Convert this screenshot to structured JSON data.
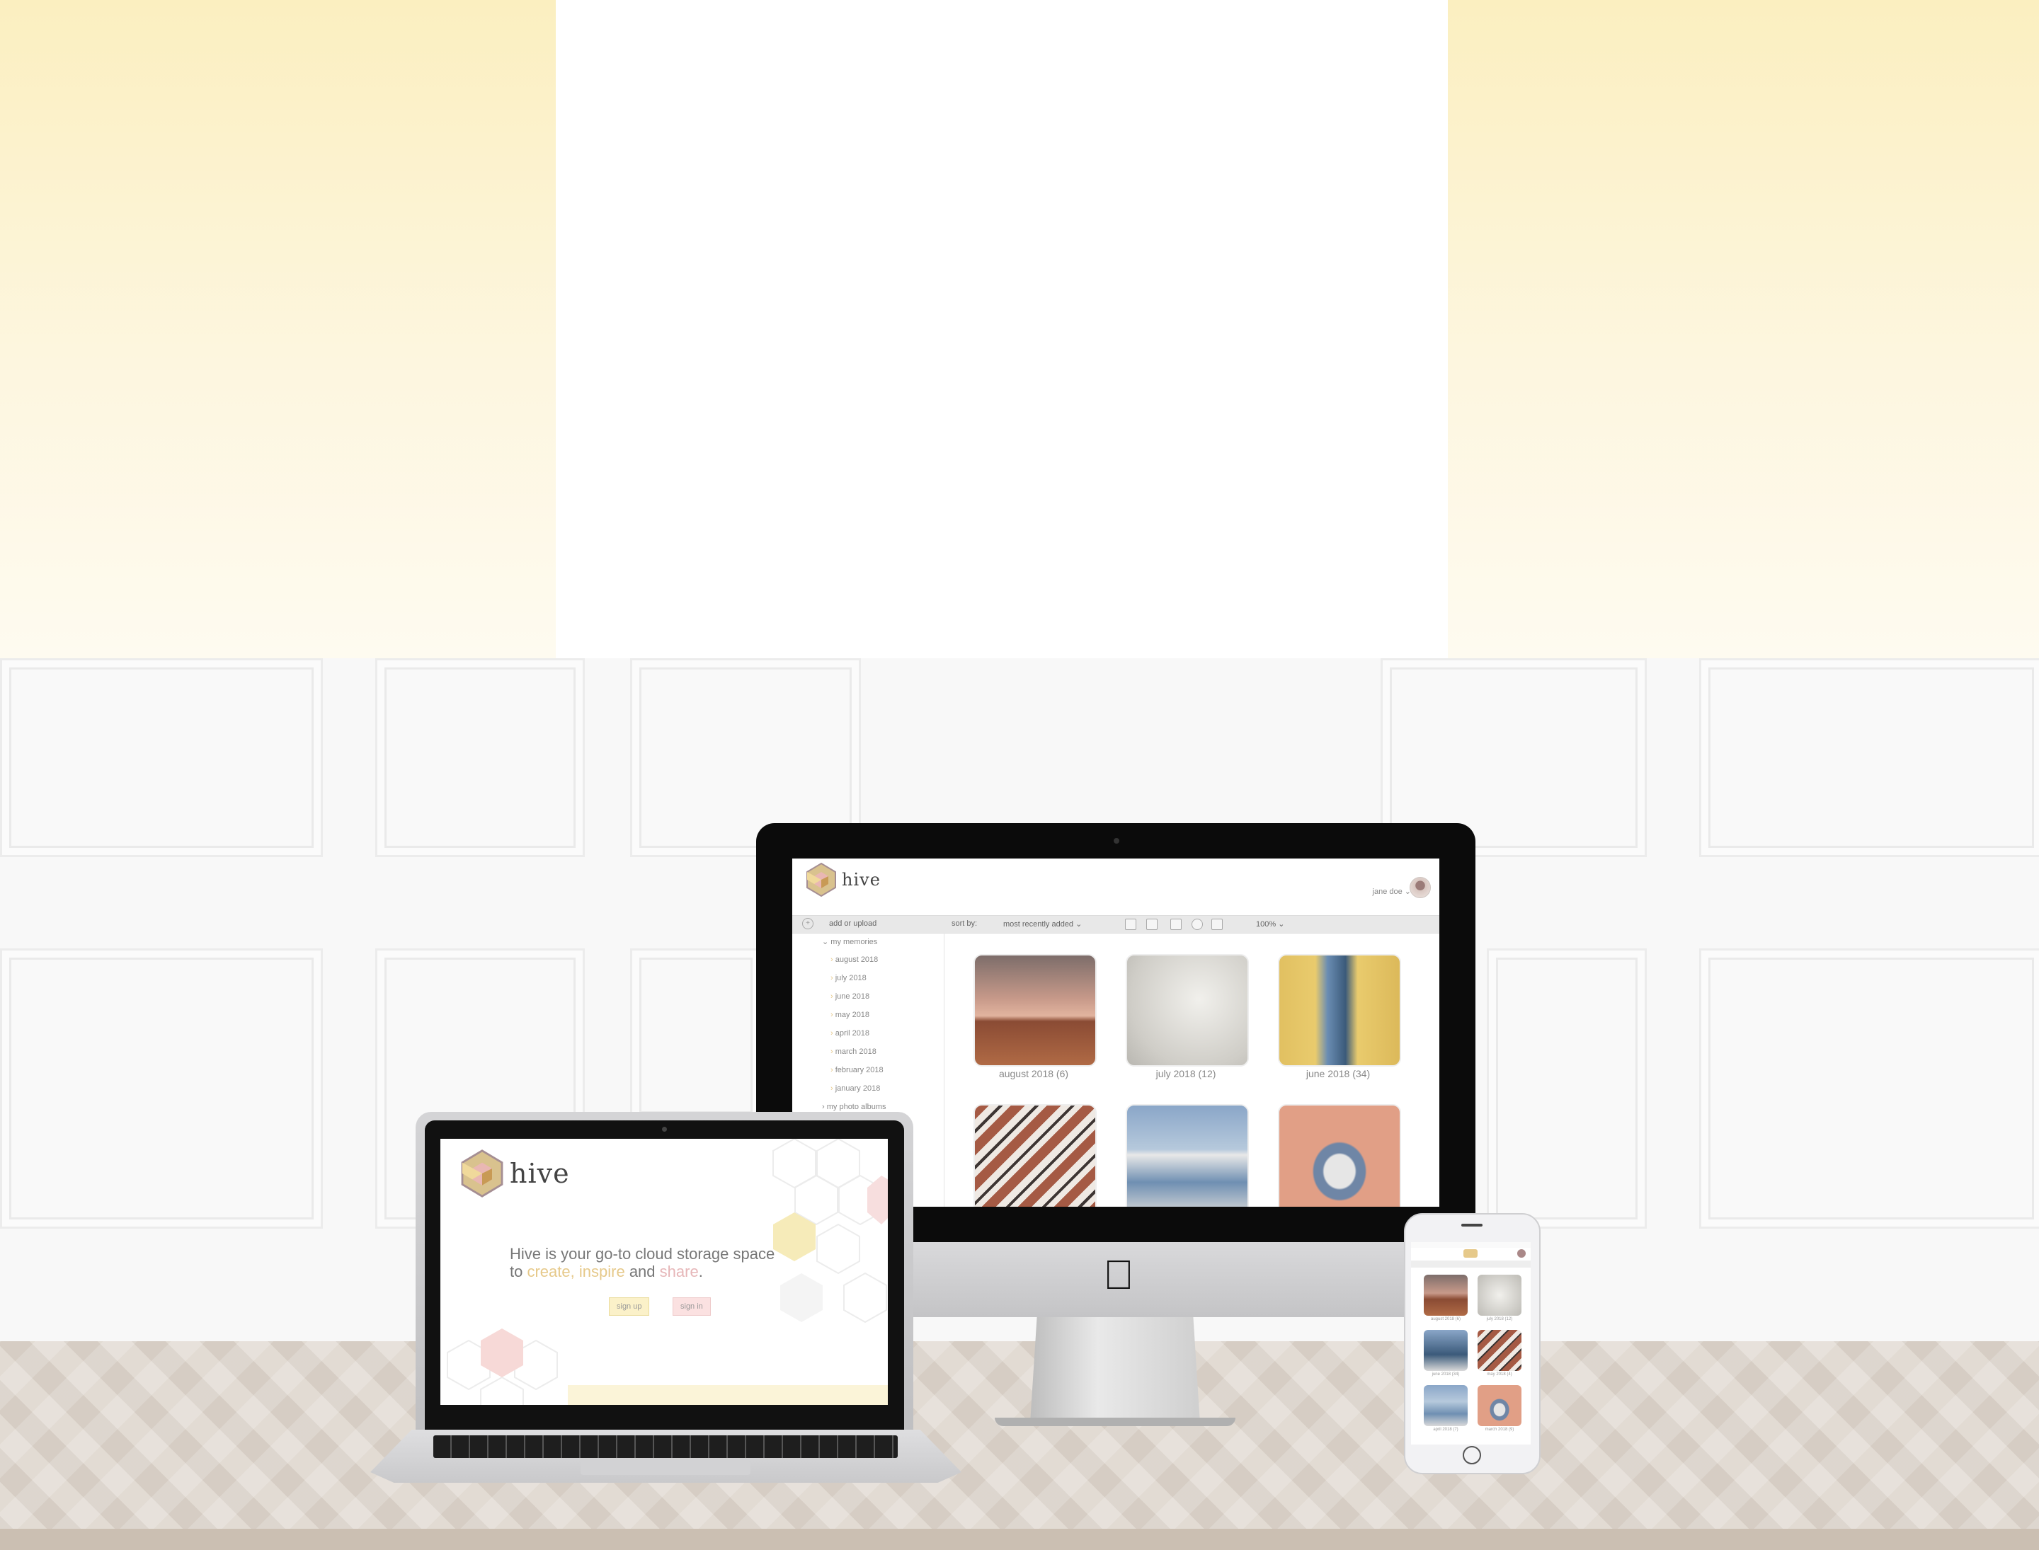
{
  "colors": {
    "accent_yellow": "#e6c98a",
    "accent_pink": "#e6b6b8",
    "background_top": "#fbefc0"
  },
  "imac": {
    "logo_text": "hive",
    "user_name": "jane doe ⌄",
    "toolbar": {
      "add_label": "add or upload",
      "sort_label": "sort by:",
      "sort_value": "most recently added ⌄",
      "zoom_value": "100% ⌄",
      "icons": [
        "document-icon",
        "image-icon",
        "video-icon",
        "globe-icon",
        "people-icon"
      ]
    },
    "sidebar": {
      "section_memories": "my memories",
      "months": [
        "august 2018",
        "july 2018",
        "june 2018",
        "may 2018",
        "april 2018",
        "march 2018",
        "february 2018",
        "january 2018"
      ],
      "section_albums": "my photo albums"
    },
    "thumbnails": [
      {
        "caption": "august 2018 (6)",
        "icon": "palm-tree-sunset-photo"
      },
      {
        "caption": "july 2018 (12)",
        "icon": "white-relief-photo"
      },
      {
        "caption": "june 2018 (34)",
        "icon": "balcony-photo"
      },
      {
        "caption": "",
        "icon": "tile-pattern-photo"
      },
      {
        "caption": "",
        "icon": "building-stairs-photo"
      },
      {
        "caption": "",
        "icon": "statue-niche-photo"
      }
    ]
  },
  "laptop": {
    "logo_text": "hive",
    "hero_pre": "Hive is your go-to cloud storage space to",
    "hero_create": "create,",
    "hero_inspire": "inspire",
    "hero_and": "and",
    "hero_share": "share",
    "hero_end": ".",
    "signup_label": "sign up",
    "signin_label": "sign in"
  },
  "phone": {
    "captions": [
      "august 2018 (6)",
      "july 2018 (12)",
      "june 2018 (34)",
      "may 2018 (4)",
      "april 2018 (7)",
      "march 2018 (9)"
    ]
  }
}
